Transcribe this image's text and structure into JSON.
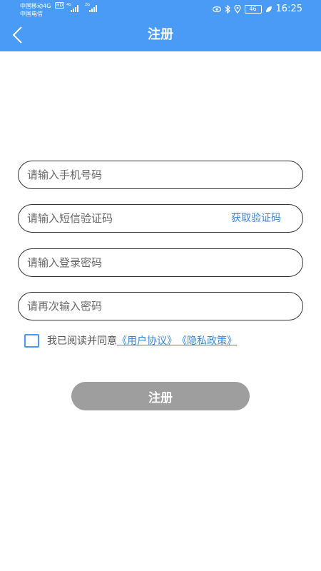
{
  "status_bar": {
    "carrier_1": "中国移动4G",
    "hd": "HD",
    "carrier_2": "中国电信",
    "signal_1": "4G",
    "signal_2": "2G",
    "battery": "46",
    "time": "16:25"
  },
  "header": {
    "title": "注册",
    "back_icon": "chevron-left-icon"
  },
  "form": {
    "phone_placeholder": "请输入手机号码",
    "sms_placeholder": "请输入短信验证码",
    "get_code_label": "获取验证码",
    "password_placeholder": "请输入登录密码",
    "confirm_placeholder": "请再次输入密码"
  },
  "agreement": {
    "text": "我已阅读并同意",
    "user_agreement": "《用户协议》",
    "privacy_policy": "《隐私政策》"
  },
  "register_button_label": "注册",
  "colors": {
    "header": "#4a9bf5",
    "link": "#3a86d8",
    "button_disabled": "#9e9e9e"
  }
}
